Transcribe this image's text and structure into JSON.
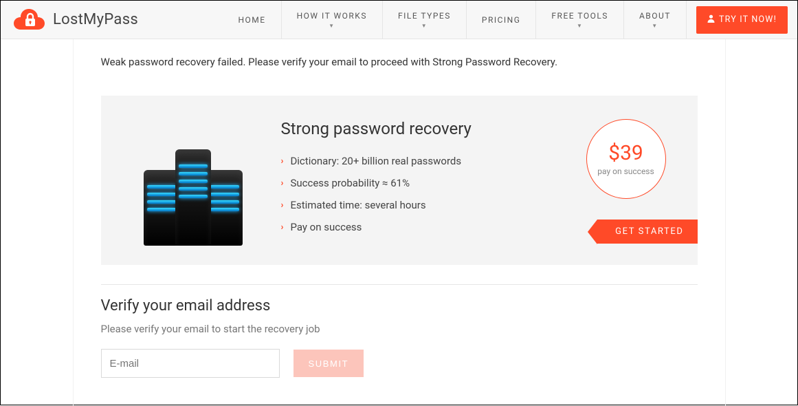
{
  "brand": "LostMyPass",
  "nav": {
    "home": "HOME",
    "how": "HOW IT WORKS",
    "files": "FILE TYPES",
    "pricing": "PRICING",
    "tools": "FREE TOOLS",
    "about": "ABOUT"
  },
  "cta": {
    "try": "TRY IT NOW!"
  },
  "fail_message": "Weak password recovery failed. Please verify your email to proceed with Strong Password Recovery.",
  "card": {
    "title": "Strong password recovery",
    "features": {
      "f1": "Dictionary: 20+ billion real passwords",
      "f2": "Success probability ≈ 61%",
      "f3": "Estimated time: several hours",
      "f4": "Pay on success"
    },
    "price": "$39",
    "price_sub": "pay on success",
    "get_started": "GET STARTED"
  },
  "verify": {
    "title": "Verify your email address",
    "subtitle": "Please verify your email to start the recovery job",
    "placeholder": "E-mail",
    "submit": "SUBMIT"
  }
}
